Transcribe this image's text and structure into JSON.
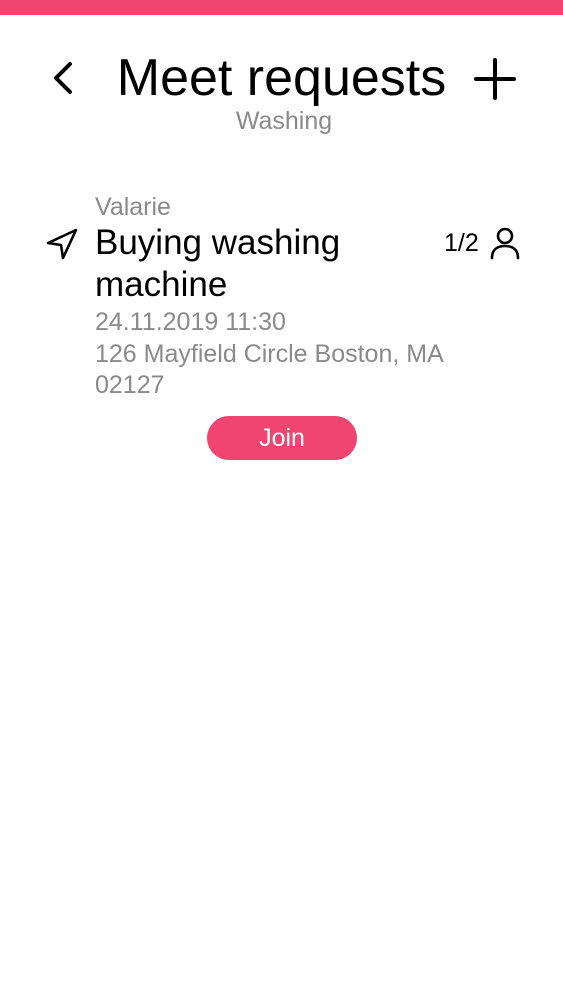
{
  "header": {
    "title": "Meet requests",
    "subtitle": "Washing",
    "back_icon": "chevron-left-icon",
    "add_icon": "plus-icon"
  },
  "colors": {
    "accent": "#ef4570",
    "muted_text": "#8a8a8a",
    "text": "#000000"
  },
  "requests": [
    {
      "author": "Valarie",
      "title": "Buying washing machine",
      "participants": "1/2",
      "datetime": "24.11.2019 11:30",
      "address": "126 Mayfield Circle Boston, MA 02127",
      "join_label": "Join",
      "location_icon": "navigation-arrow-icon",
      "participants_icon": "person-icon"
    }
  ]
}
